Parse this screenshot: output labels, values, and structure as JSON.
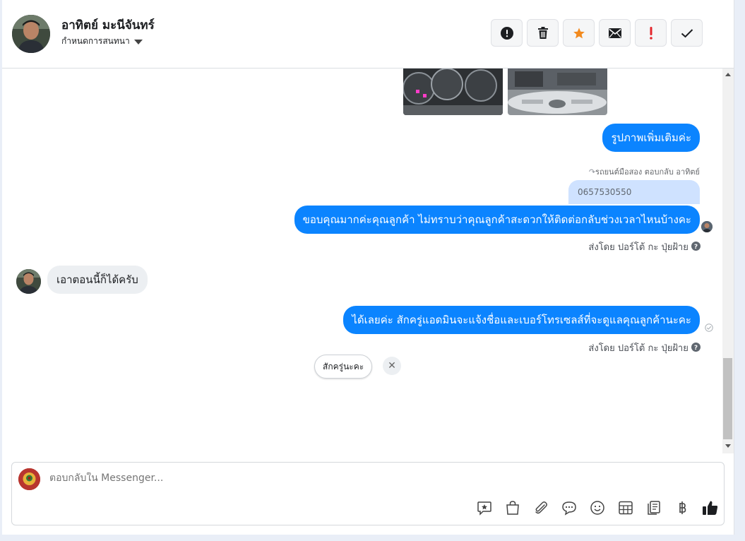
{
  "header": {
    "contact_name": "อาทิตย์ มะนีจันทร์",
    "assign_label": "กำหนดการสนทนา",
    "actions": [
      {
        "name": "report-spam-button",
        "icon": "alert-circle-icon"
      },
      {
        "name": "delete-button",
        "icon": "trash-icon"
      },
      {
        "name": "star-button",
        "icon": "star-icon"
      },
      {
        "name": "mark-unread-button",
        "icon": "envelope-icon"
      },
      {
        "name": "flag-important-button",
        "icon": "exclamation-icon"
      },
      {
        "name": "mark-done-button",
        "icon": "checkmark-icon"
      }
    ]
  },
  "messages": {
    "photo_caption": "รูปภาพเพิ่มเติมค่ะ",
    "reply_context": "รถยนต์มือสอง ตอบกลับ อาทิตย์",
    "quoted_text": "0657530550",
    "reply_text": "ขอบคุณมากค่ะคุณลูกค้า ไม่ทราบว่าคุณลูกค้าสะดวกให้ติดต่อกลับช่วงเวลาไหนบ้างคะ",
    "sent_by_1": "ส่งโดย ปอร์โต้ กะ ปุ่ยฝ้าย",
    "incoming_text": "เอาตอนนี้ก็ได้ครับ",
    "reply2_text": "ได้เลยค่ะ สักครู่แอดมินจะแจ้งชื่อและเบอร์โทรเซลส์ที่จะดูแลคุณลูกค้านะคะ",
    "sent_by_2": "ส่งโดย ปอร์โต้ กะ ปุ่ยฝ้าย",
    "help_icon": "question-circle-icon",
    "seen_icon": "check-circle-icon"
  },
  "suggestion": {
    "chip_label": "สักครู่นะคะ",
    "dismiss_icon": "close-icon"
  },
  "composer": {
    "placeholder": "ตอบกลับใน Messenger...",
    "tools": [
      "quick-reply-icon",
      "shop-bag-icon",
      "paperclip-icon",
      "saved-reply-icon",
      "emoji-icon",
      "table-icon",
      "document-icon",
      "baht-icon",
      "thumbs-up-icon"
    ]
  },
  "colors": {
    "outgoing_bubble": "#0B84FF",
    "incoming_bubble": "#ECEFF2",
    "quote_bubble": "#CFE2FF",
    "star": "#F28A1E",
    "exclamation": "#E4262C"
  }
}
